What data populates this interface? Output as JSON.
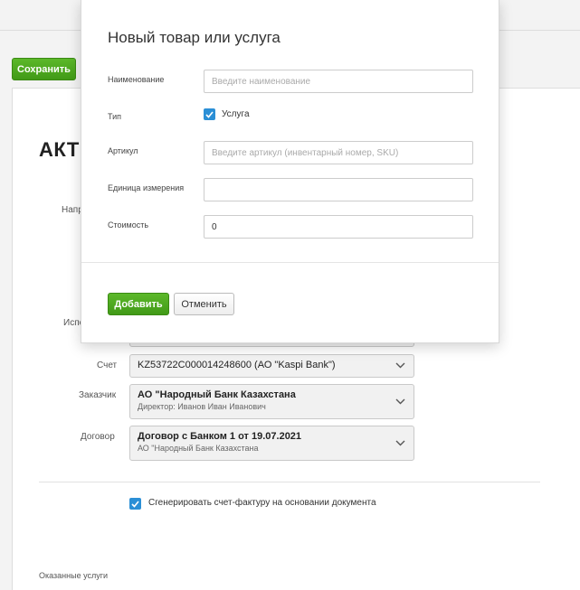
{
  "toolbar": {
    "save_label": "Сохранить"
  },
  "document": {
    "title": "АКТ",
    "labels": {
      "direction_partial": "Напр",
      "executor_partial": "Испо",
      "account": "Счет",
      "customer": "Заказчик",
      "contract": "Договор"
    },
    "account": {
      "value": "KZ53722C000014248600 (АО \"Kaspi Bank\")"
    },
    "customer": {
      "value": "АО \"Народный Банк Казахстана",
      "sub": "Директор: Иванов Иван Иванович"
    },
    "contract": {
      "value": "Договор с Банком 1 от 19.07.2021",
      "sub": "АО \"Народный Банк Казахстана"
    },
    "generate_invoice": {
      "label": "Сгенерировать счет-фактуру на основании документа",
      "checked": true
    },
    "services_label": "Оказанные услуги"
  },
  "modal": {
    "title": "Новый товар или услуга",
    "fields": {
      "name": {
        "label": "Наименование",
        "placeholder": "Введите наименование",
        "value": ""
      },
      "type": {
        "label": "Тип",
        "option_label": "Услуга",
        "checked": true
      },
      "sku": {
        "label": "Артикул",
        "placeholder": "Введите артикул (инвентарный номер, SKU)",
        "value": ""
      },
      "unit": {
        "label": "Единица измерения",
        "value": ""
      },
      "price": {
        "label": "Стоимость",
        "value": "0"
      }
    },
    "add_label": "Добавить",
    "cancel_label": "Отменить"
  },
  "colors": {
    "accent_green": "#4aa51f",
    "checkbox_blue": "#2b8fd6"
  }
}
